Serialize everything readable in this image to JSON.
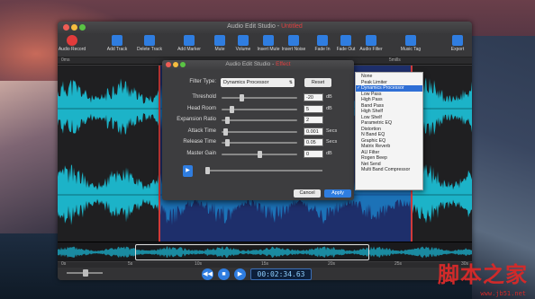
{
  "app": {
    "title_prefix": "Audio Edit Studio - ",
    "title_doc": "Untitled"
  },
  "toolbar": {
    "items": [
      {
        "label": "Audio Record",
        "icon": "record-icon",
        "color": "#e23b3b"
      },
      {
        "label": "Add Track",
        "icon": "add-track-icon",
        "color": "#2f7de0"
      },
      {
        "label": "Delete Track",
        "icon": "delete-track-icon",
        "color": "#2f7de0"
      },
      {
        "label": "Add Marker",
        "icon": "marker-icon",
        "color": "#2f7de0"
      },
      {
        "label": "Mute",
        "icon": "mute-icon",
        "color": "#2f7de0"
      },
      {
        "label": "Volume",
        "icon": "volume-icon",
        "color": "#2f7de0"
      },
      {
        "label": "Insert Mute",
        "icon": "insert-mute-icon",
        "color": "#2f7de0"
      },
      {
        "label": "Insert Noise",
        "icon": "insert-noise-icon",
        "color": "#2f7de0"
      },
      {
        "label": "Fade In",
        "icon": "fade-in-icon",
        "color": "#2f7de0"
      },
      {
        "label": "Fade Out",
        "icon": "fade-out-icon",
        "color": "#2f7de0"
      },
      {
        "label": "Audio Filter",
        "icon": "audio-filter-icon",
        "color": "#2f7de0"
      },
      {
        "label": "Music Tag",
        "icon": "music-tag-icon",
        "color": "#2f7de0"
      },
      {
        "label": "Export",
        "icon": "export-icon",
        "color": "#2f7de0"
      }
    ]
  },
  "ruler_top": {
    "start": "0ms",
    "end": "5mills"
  },
  "ruler_bottom": {
    "labels": [
      "0s",
      "5s",
      "10s",
      "15s",
      "20s",
      "25s",
      "30s"
    ]
  },
  "transport": {
    "timecode": "00:02:34.63"
  },
  "dialog": {
    "title_prefix": "Audio Edit Studio - ",
    "title_doc": "Effect",
    "filter_type_label": "Filter Type:",
    "filter_type_value": "Dynamics Processor",
    "reset_label": "Reset",
    "params": [
      {
        "label": "Threshold",
        "value": "-20",
        "unit": "dB",
        "level": 0.25
      },
      {
        "label": "Head Room",
        "value": "5",
        "unit": "dB",
        "level": 0.12
      },
      {
        "label": "Expansion Ratio",
        "value": "2",
        "unit": "",
        "level": 0.05
      },
      {
        "label": "Attack Time",
        "value": "0.001",
        "unit": "Secs",
        "level": 0.02
      },
      {
        "label": "Release Time",
        "value": "0.05",
        "unit": "Secs",
        "level": 0.05
      },
      {
        "label": "Master Gain",
        "value": "0",
        "unit": "dB",
        "level": 0.5
      }
    ],
    "cancel_label": "Cancel",
    "apply_label": "Apply"
  },
  "filter_menu": {
    "selected": "Dynamics Processor",
    "items": [
      "None",
      "Peak Limiter",
      "Dynamics Processor",
      "Low Pass",
      "High Pass",
      "Band Pass",
      "High Shelf",
      "Low Shelf",
      "Parametric EQ",
      "Distortion",
      "N Band EQ",
      "Graphic EQ",
      "Matrix Reverb",
      "AU Filter",
      "Rogen Beep",
      "Net Send",
      "Multi Band Compressor"
    ]
  },
  "watermark": {
    "text": "脚本之家",
    "url": "www.jb51.net"
  }
}
